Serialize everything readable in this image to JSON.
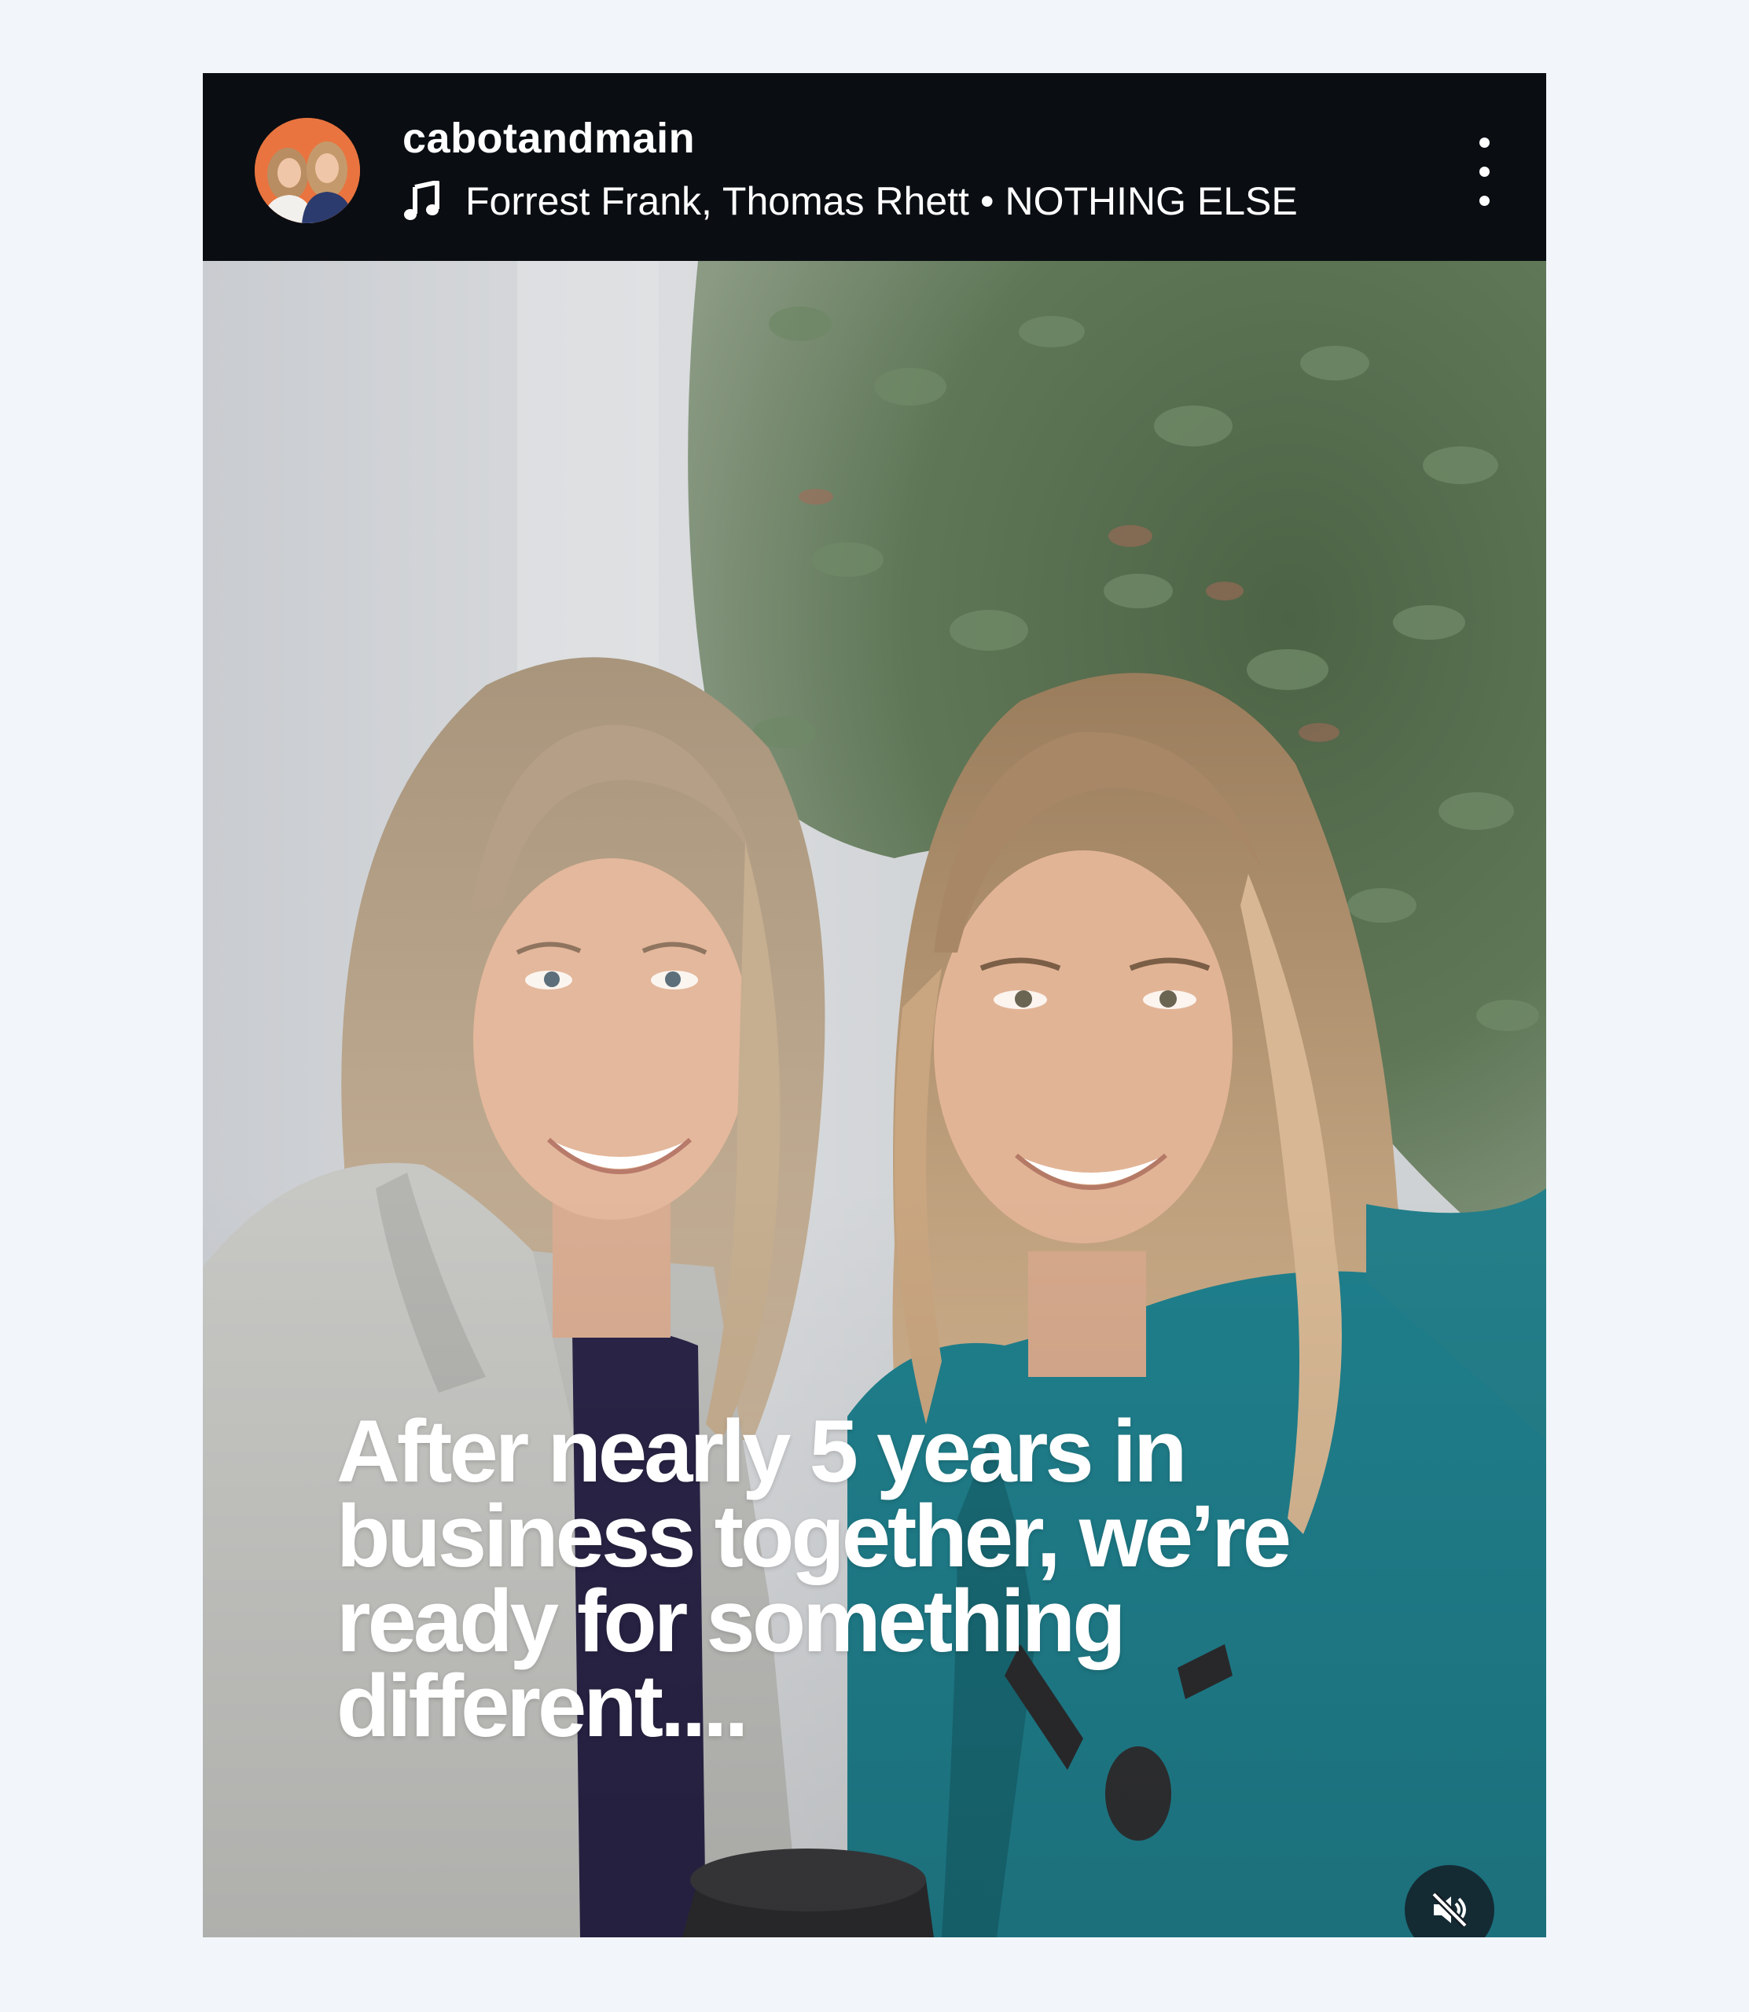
{
  "header": {
    "username": "cabotandmain",
    "audio": {
      "artists": "Forrest Frank, Thomas Rhett",
      "separator": "•",
      "track": "NOTHING ELSE"
    }
  },
  "media": {
    "caption": "After nearly 5 years in business together, we’re ready for something different...."
  },
  "icons": {
    "music": "music-note-icon",
    "more": "more-options-icon",
    "mute": "speaker-muted-icon"
  },
  "colors": {
    "header_bg": "#0a0d12",
    "page_bg": "#f2f6fb",
    "avatar_bg": "#e9743f",
    "text": "#ffffff",
    "jacket_teal": "#1f7f8c"
  }
}
